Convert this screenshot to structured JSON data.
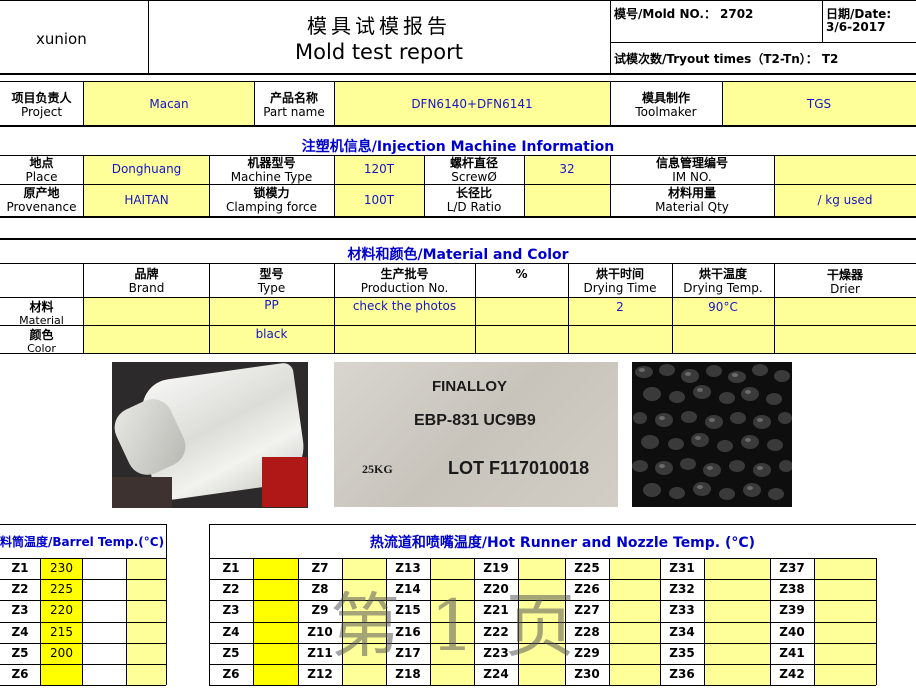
{
  "header": {
    "company": "xunion",
    "title_zh": "模具试模报告",
    "title_en": "Mold test report",
    "mold_no_label": "模号/Mold NO.：",
    "mold_no": "2702",
    "date_label": "日期/Date:",
    "date": "3/6-2017",
    "tryout_label": "试模次数/Tryout times（T2-Tn）：",
    "tryout": "T2"
  },
  "project": {
    "project_zh": "项目负责人",
    "project_en": "Project",
    "project_value": "Macan",
    "part_zh": "产品名称",
    "part_en": "Part name",
    "part_value": "DFN6140+DFN6141",
    "toolmaker_zh": "模具制作",
    "toolmaker_en": "Toolmaker",
    "toolmaker_value": "TGS"
  },
  "machine": {
    "section_title": "注塑机信息/Injection Machine Information",
    "place_zh": "地点",
    "place_en": "Place",
    "place_value": "Donghuang",
    "type_zh": "机器型号",
    "type_en": "Machine Type",
    "type_value": "120T",
    "screw_zh": "螺杆直径",
    "screw_en": "ScrewØ",
    "screw_value": "32",
    "im_zh": "信息管理编号",
    "im_en": "IM NO.",
    "im_value": "",
    "prov_zh": "原产地",
    "prov_en": "Provenance",
    "prov_value": "HAITAN",
    "clamp_zh": "锁模力",
    "clamp_en": "Clamping force",
    "clamp_value": "100T",
    "ld_zh": "长径比",
    "ld_en": "L/D Ratio",
    "ld_value": "",
    "qty_zh": "材料用量",
    "qty_en": "Material Qty",
    "qty_value": "/  kg used"
  },
  "material": {
    "section_title": "材料和颜色/Material and Color",
    "brand_zh": "品牌",
    "brand_en": "Brand",
    "type_zh": "型号",
    "type_en": "Type",
    "prod_zh": "生产批号",
    "prod_en": "Production No.",
    "percent": "%",
    "dtime_zh": "烘干时间",
    "dtime_en": "Drying Time",
    "dtemp_zh": "烘干温度",
    "dtemp_en": "Drying Temp.",
    "drier_zh": "干燥器",
    "drier_en": "Drier",
    "material_zh": "材料",
    "material_en": "Material",
    "material_type": "PP",
    "material_prod": "check the photos",
    "material_dtime": "2",
    "material_dtemp": "90°C",
    "color_zh": "颜色",
    "color_en": "Color",
    "color_type": "black"
  },
  "photos": {
    "label_line1": "FINALLOY",
    "label_line2": "EBP-831 UC9B9",
    "label_weight": "25KG",
    "label_lot": "LOT F117010018"
  },
  "barrel": {
    "title": "料筒温度/Barrel Temp.(°C)",
    "zones": [
      {
        "label": "Z1",
        "value": "230"
      },
      {
        "label": "Z2",
        "value": "225"
      },
      {
        "label": "Z3",
        "value": "220"
      },
      {
        "label": "Z4",
        "value": "215"
      },
      {
        "label": "Z5",
        "value": "200"
      },
      {
        "label": "Z6",
        "value": ""
      }
    ]
  },
  "hotrunner": {
    "title": "热流道和喷嘴温度/Hot Runner and Nozzle Temp. (°C)",
    "columns": [
      [
        "Z1",
        "Z2",
        "Z3",
        "Z4",
        "Z5",
        "Z6"
      ],
      [
        "Z7",
        "Z8",
        "Z9",
        "Z10",
        "Z11",
        "Z12"
      ],
      [
        "Z13",
        "Z14",
        "Z15",
        "Z16",
        "Z17",
        "Z18"
      ],
      [
        "Z19",
        "Z20",
        "Z21",
        "Z22",
        "Z23",
        "Z24"
      ],
      [
        "Z25",
        "Z26",
        "Z27",
        "Z28",
        "Z29",
        "Z30"
      ],
      [
        "Z31",
        "Z32",
        "Z33",
        "Z34",
        "Z35",
        "Z36"
      ],
      [
        "Z37",
        "Z38",
        "Z39",
        "Z40",
        "Z41",
        "Z42"
      ]
    ]
  },
  "watermark": "第 1 页",
  "colors": {
    "yellow_light": "#ffff99",
    "yellow_bright": "#ffff00",
    "blue_text": "#1515c8",
    "section_blue": "#0000cc"
  }
}
